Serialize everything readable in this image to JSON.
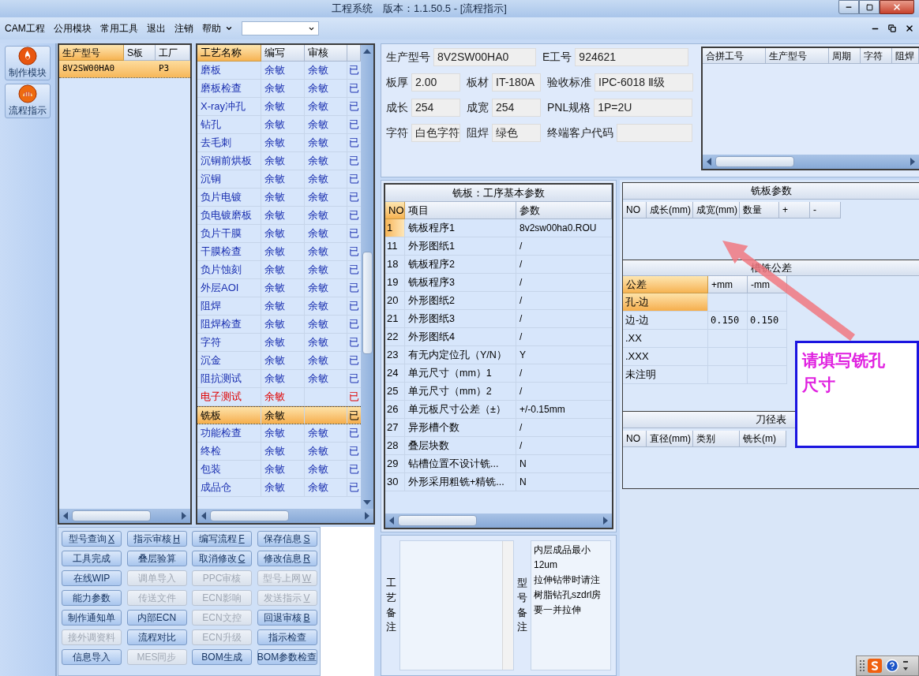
{
  "window": {
    "title": "工程系统　版本：1.1.50.5 - [流程指示]"
  },
  "menu": [
    "CAM工程",
    "公用模块",
    "常用工具",
    "退出",
    "注销",
    "帮助"
  ],
  "nav": [
    {
      "label": "制作模块",
      "kind": "flame"
    },
    {
      "label": "流程指示",
      "kind": "shell"
    }
  ],
  "models": {
    "columns": [
      "生产型号",
      "S板",
      "工厂"
    ],
    "rows": [
      {
        "model": "8V2SW00HA0",
        "factory": "P3",
        "selected": true
      }
    ]
  },
  "processes": {
    "columns": [
      "工艺名称",
      "编写",
      "审核"
    ],
    "rows": [
      {
        "name": "磨板",
        "writer": "余敏",
        "reviewer": "余敏",
        "status": "已",
        "selected": false,
        "alert": false
      },
      {
        "name": "磨板检查",
        "writer": "余敏",
        "reviewer": "余敏",
        "status": "已",
        "selected": false,
        "alert": false
      },
      {
        "name": "X-ray冲孔",
        "writer": "余敏",
        "reviewer": "余敏",
        "status": "已",
        "selected": false,
        "alert": false
      },
      {
        "name": "钻孔",
        "writer": "余敏",
        "reviewer": "余敏",
        "status": "已",
        "selected": false,
        "alert": false
      },
      {
        "name": "去毛刺",
        "writer": "余敏",
        "reviewer": "余敏",
        "status": "已",
        "selected": false,
        "alert": false
      },
      {
        "name": "沉铜前烘板",
        "writer": "余敏",
        "reviewer": "余敏",
        "status": "已",
        "selected": false,
        "alert": false
      },
      {
        "name": "沉铜",
        "writer": "余敏",
        "reviewer": "余敏",
        "status": "已",
        "selected": false,
        "alert": false
      },
      {
        "name": "负片电镀",
        "writer": "余敏",
        "reviewer": "余敏",
        "status": "已",
        "selected": false,
        "alert": false
      },
      {
        "name": "负电镀磨板",
        "writer": "余敏",
        "reviewer": "余敏",
        "status": "已",
        "selected": false,
        "alert": false
      },
      {
        "name": "负片干膜",
        "writer": "余敏",
        "reviewer": "余敏",
        "status": "已",
        "selected": false,
        "alert": false
      },
      {
        "name": "干膜检查",
        "writer": "余敏",
        "reviewer": "余敏",
        "status": "已",
        "selected": false,
        "alert": false
      },
      {
        "name": "负片蚀刻",
        "writer": "余敏",
        "reviewer": "余敏",
        "status": "已",
        "selected": false,
        "alert": false
      },
      {
        "name": "外层AOI",
        "writer": "余敏",
        "reviewer": "余敏",
        "status": "已",
        "selected": false,
        "alert": false
      },
      {
        "name": "阻焊",
        "writer": "余敏",
        "reviewer": "余敏",
        "status": "已",
        "selected": false,
        "alert": false
      },
      {
        "name": "阻焊检查",
        "writer": "余敏",
        "reviewer": "余敏",
        "status": "已",
        "selected": false,
        "alert": false
      },
      {
        "name": "字符",
        "writer": "余敏",
        "reviewer": "余敏",
        "status": "已",
        "selected": false,
        "alert": false
      },
      {
        "name": "沉金",
        "writer": "余敏",
        "reviewer": "余敏",
        "status": "已",
        "selected": false,
        "alert": false
      },
      {
        "name": "阻抗测试",
        "writer": "余敏",
        "reviewer": "余敏",
        "status": "已",
        "selected": false,
        "alert": false
      },
      {
        "name": "电子测试",
        "writer": "余敏",
        "status": "已",
        "selected": false,
        "alert": true
      },
      {
        "name": "铣板",
        "writer": "余敏",
        "status": "已",
        "selected": true,
        "alert": false
      },
      {
        "name": "功能检查",
        "writer": "余敏",
        "reviewer": "余敏",
        "status": "已",
        "selected": false,
        "alert": false
      },
      {
        "name": "终检",
        "writer": "余敏",
        "reviewer": "余敏",
        "status": "已",
        "selected": false,
        "alert": false
      },
      {
        "name": "包装",
        "writer": "余敏",
        "reviewer": "余敏",
        "status": "已",
        "selected": false,
        "alert": false
      },
      {
        "name": "成品仓",
        "writer": "余敏",
        "reviewer": "余敏",
        "status": "已",
        "selected": false,
        "alert": false
      }
    ]
  },
  "buttons": [
    {
      "label": "型号查询",
      "hotkey": "X",
      "disabled": false
    },
    {
      "label": "指示审核",
      "hotkey": "H",
      "disabled": false
    },
    {
      "label": "编写流程",
      "hotkey": "F",
      "disabled": false
    },
    {
      "label": "保存信息",
      "hotkey": "S",
      "disabled": false
    },
    {
      "label": "工具完成",
      "disabled": false
    },
    {
      "label": "叠层验算",
      "disabled": false
    },
    {
      "label": "取消修改",
      "hotkey": "C",
      "disabled": false
    },
    {
      "label": "修改信息",
      "hotkey": "R",
      "disabled": false
    },
    {
      "label": "在线WIP",
      "disabled": false
    },
    {
      "label": "调单导入",
      "disabled": true
    },
    {
      "label": "PPC审核",
      "disabled": true
    },
    {
      "label": "型号上网",
      "hotkey": "W",
      "disabled": true
    },
    {
      "label": "能力参数",
      "disabled": false
    },
    {
      "label": "传送文件",
      "disabled": true
    },
    {
      "label": "ECN影响",
      "disabled": true
    },
    {
      "label": "发送指示",
      "hotkey": "V",
      "disabled": true
    },
    {
      "label": "制作通知单",
      "disabled": false
    },
    {
      "label": "内部ECN",
      "disabled": false
    },
    {
      "label": "ECN文控",
      "disabled": true
    },
    {
      "label": "回退审核",
      "hotkey": "B",
      "disabled": false
    },
    {
      "label": "接外调资料",
      "disabled": true
    },
    {
      "label": "流程对比",
      "disabled": false
    },
    {
      "label": "ECN升级",
      "disabled": true
    },
    {
      "label": "指示检查",
      "disabled": false
    },
    {
      "label": "信息导入",
      "disabled": false
    },
    {
      "label": "MES同步",
      "disabled": true
    },
    {
      "label": "BOM生成",
      "disabled": false
    },
    {
      "label": "BOM参数检查",
      "disabled": false
    }
  ],
  "info": {
    "fields": [
      {
        "label": "生产型号",
        "value": "8V2SW00HA0"
      },
      {
        "label": "E工号",
        "value": "924621"
      },
      {
        "label": "板厚",
        "value": "2.00"
      },
      {
        "label": "板材",
        "value": "IT-180A"
      },
      {
        "label": "验收标准",
        "value": "IPC-6018 Ⅱ级"
      },
      {
        "label": "成长",
        "value": "254"
      },
      {
        "label": "成宽",
        "value": "254"
      },
      {
        "label": "PNL规格",
        "value": "1P=2U"
      },
      {
        "label": "字符",
        "value": "白色字符"
      },
      {
        "label": "阻焊",
        "value": "绿色"
      },
      {
        "label": "终端客户代码"
      }
    ]
  },
  "merge_table": {
    "columns": [
      "合拼工号",
      "生产型号",
      "周期",
      "字符",
      "阻焊"
    ]
  },
  "mill_params": {
    "title": "铣板：工序基本参数",
    "columns": [
      "NO",
      "项目",
      "参数"
    ],
    "rows": [
      {
        "no": "1",
        "item": "铣板程序1",
        "value": "8v2sw00ha0.ROU",
        "selected": true
      },
      {
        "no": "11",
        "item": "外形图纸1",
        "value": "/",
        "selected": false
      },
      {
        "no": "18",
        "item": "铣板程序2",
        "value": "/",
        "selected": false
      },
      {
        "no": "19",
        "item": "铣板程序3",
        "value": "/",
        "selected": false
      },
      {
        "no": "20",
        "item": "外形图纸2",
        "value": "/",
        "selected": false
      },
      {
        "no": "21",
        "item": "外形图纸3",
        "value": "/",
        "selected": false
      },
      {
        "no": "22",
        "item": "外形图纸4",
        "value": "/",
        "selected": false
      },
      {
        "no": "23",
        "item": "有无内定位孔（Y/N）",
        "value": "Y",
        "selected": false
      },
      {
        "no": "24",
        "item": "单元尺寸（mm）1",
        "value": "/",
        "selected": false
      },
      {
        "no": "25",
        "item": "单元尺寸（mm）2",
        "value": "/",
        "selected": false
      },
      {
        "no": "26",
        "item": "单元板尺寸公差（±）",
        "value": "+/-0.15mm",
        "selected": false
      },
      {
        "no": "27",
        "item": "异形槽个数",
        "value": "/",
        "selected": false
      },
      {
        "no": "28",
        "item": "叠层块数",
        "value": "/",
        "selected": false
      },
      {
        "no": "29",
        "item": "钻槽位置不设计铣...",
        "value": "N",
        "selected": false
      },
      {
        "no": "30",
        "item": "外形采用粗铣+精铣...",
        "value": "N",
        "selected": false
      }
    ]
  },
  "mill_board": {
    "title": "铣板参数",
    "columns": [
      "NO",
      "成长(mm)",
      "成宽(mm)",
      "数量",
      "+",
      "-"
    ]
  },
  "slot_tolerance": {
    "title": "槽铣公差",
    "columns": [
      "公差",
      "+mm",
      "-mm"
    ],
    "rows": [
      {
        "name": "孔-边",
        "selected": true
      },
      {
        "name": "边-边",
        "plus": "0.150",
        "minus": "0.150",
        "selected": false
      },
      {
        "name": ".XX",
        "selected": false
      },
      {
        "name": ".XXX",
        "selected": false
      },
      {
        "name": "未注明",
        "selected": false
      }
    ]
  },
  "tool_table": {
    "title": "刀径表",
    "columns": [
      "NO",
      "直径(mm)",
      "类别",
      "铣长(m)"
    ]
  },
  "remarks": [
    {
      "label": "工艺备注"
    },
    {
      "label": "型号备注",
      "lines": [
        "内层成品最小",
        "12um",
        "拉伸钻带时请注",
        "树脂钻孔szdrl房",
        "要一并拉伸"
      ]
    }
  ],
  "annotation": {
    "text": "请填写铣孔尺寸"
  }
}
